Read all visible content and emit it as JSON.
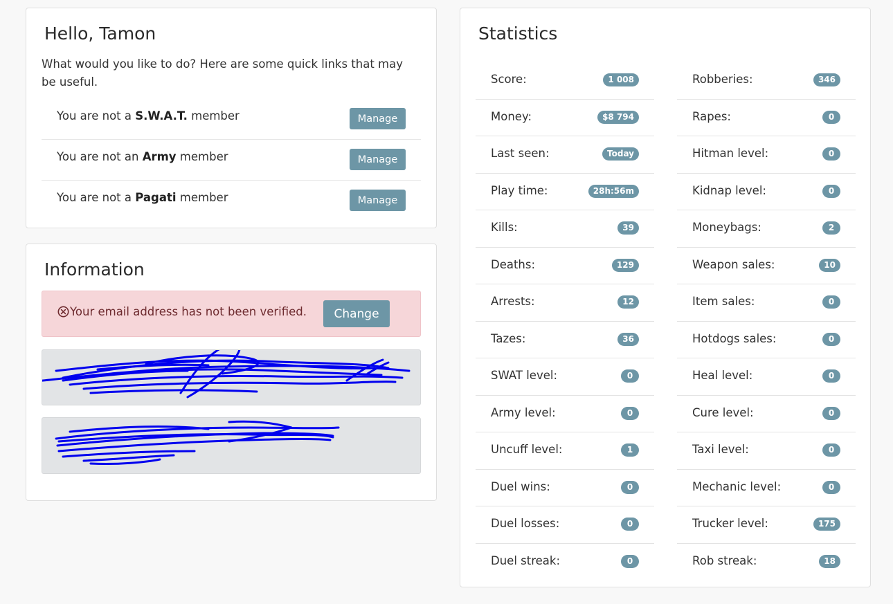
{
  "hello_card": {
    "title": "Hello, Tamon",
    "intro": "What would you like to do? Here are some quick links that may be useful.",
    "memberships": [
      {
        "prefix": "You are not a ",
        "group": "S.W.A.T.",
        "suffix": " member",
        "button": "Manage"
      },
      {
        "prefix": "You are not an ",
        "group": "Army",
        "suffix": " member",
        "button": "Manage"
      },
      {
        "prefix": "You are not a ",
        "group": "Pagati",
        "suffix": " member",
        "button": "Manage"
      }
    ]
  },
  "info_card": {
    "title": "Information",
    "alert": {
      "icon": "circle-x-icon",
      "text": "Your email address has not been verified.",
      "button": "Change",
      "color": "#f6d6d9"
    }
  },
  "stats_card": {
    "title": "Statistics",
    "left": [
      {
        "label": "Score:",
        "value": "1 008"
      },
      {
        "label": "Money:",
        "value": "$8 794"
      },
      {
        "label": "Last seen:",
        "value": "Today"
      },
      {
        "label": "Play time:",
        "value": "28h:56m"
      },
      {
        "label": "Kills:",
        "value": "39"
      },
      {
        "label": "Deaths:",
        "value": "129"
      },
      {
        "label": "Arrests:",
        "value": "12"
      },
      {
        "label": "Tazes:",
        "value": "36"
      },
      {
        "label": "SWAT level:",
        "value": "0"
      },
      {
        "label": "Army level:",
        "value": "0"
      },
      {
        "label": "Uncuff level:",
        "value": "1"
      },
      {
        "label": "Duel wins:",
        "value": "0"
      },
      {
        "label": "Duel losses:",
        "value": "0"
      },
      {
        "label": "Duel streak:",
        "value": "0"
      }
    ],
    "right": [
      {
        "label": "Robberies:",
        "value": "346"
      },
      {
        "label": "Rapes:",
        "value": "0"
      },
      {
        "label": "Hitman level:",
        "value": "0"
      },
      {
        "label": "Kidnap level:",
        "value": "0"
      },
      {
        "label": "Moneybags:",
        "value": "2"
      },
      {
        "label": "Weapon sales:",
        "value": "10"
      },
      {
        "label": "Item sales:",
        "value": "0"
      },
      {
        "label": "Hotdogs sales:",
        "value": "0"
      },
      {
        "label": "Heal level:",
        "value": "0"
      },
      {
        "label": "Cure level:",
        "value": "0"
      },
      {
        "label": "Taxi level:",
        "value": "0"
      },
      {
        "label": "Mechanic level:",
        "value": "0"
      },
      {
        "label": "Trucker level:",
        "value": "175"
      },
      {
        "label": "Rob streak:",
        "value": "18"
      }
    ]
  },
  "colors": {
    "accent": "#6d96a6",
    "background": "#f8f8f8",
    "scribble": "#0000ee"
  }
}
